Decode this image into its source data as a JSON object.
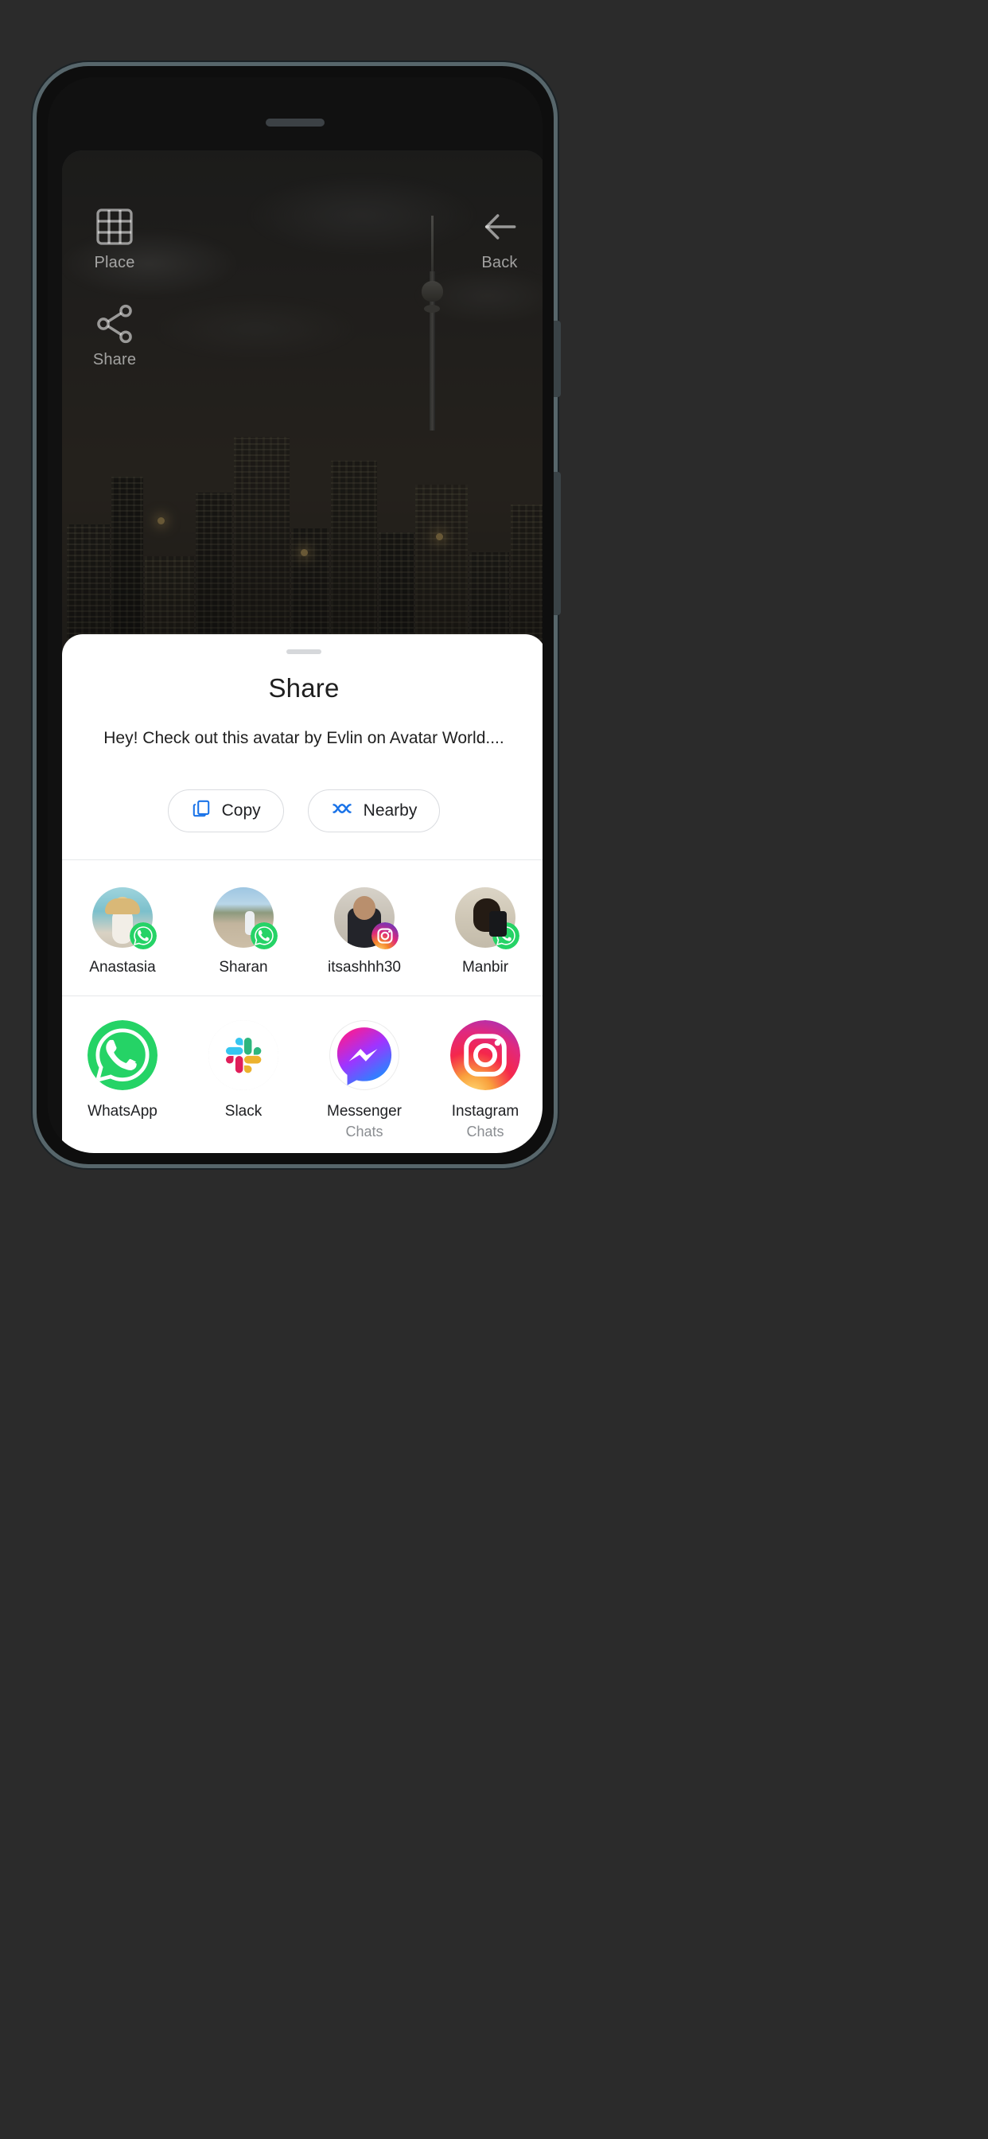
{
  "overlay": {
    "place_label": "Place",
    "share_label": "Share",
    "back_label": "Back",
    "place_icon": "grid-icon",
    "share_icon": "share-nodes-icon",
    "back_icon": "arrow-left-icon"
  },
  "sheet": {
    "title": "Share",
    "subtitle": "Hey! Check out this avatar by Evlin on Avatar World....",
    "chips": [
      {
        "label": "Copy",
        "icon": "copy-icon",
        "icon_color": "#1a73e8"
      },
      {
        "label": "Nearby",
        "icon": "nearby-share-icon",
        "icon_color": "#1a73e8"
      }
    ],
    "contacts": [
      {
        "name": "Anastasia",
        "app_badge": "whatsapp-icon",
        "badge_color": "#25D366"
      },
      {
        "name": "Sharan",
        "app_badge": "whatsapp-icon",
        "badge_color": "#25D366"
      },
      {
        "name": "itsashhh30",
        "app_badge": "instagram-icon",
        "badge_color": "#E1306C"
      },
      {
        "name": "Manbir",
        "app_badge": "whatsapp-icon",
        "badge_color": "#25D366"
      }
    ],
    "apps": [
      {
        "name": "WhatsApp",
        "sublabel": "",
        "icon": "whatsapp-icon",
        "color": "#25D366"
      },
      {
        "name": "Slack",
        "sublabel": "",
        "icon": "slack-icon",
        "color": "#ECB22E"
      },
      {
        "name": "Messenger",
        "sublabel": "Chats",
        "icon": "messenger-icon",
        "color": "#A033FF"
      },
      {
        "name": "Instagram",
        "sublabel": "Chats",
        "icon": "instagram-icon",
        "color": "#E1306C"
      }
    ]
  },
  "colors": {
    "accent_blue": "#1a73e8",
    "sheet_background": "#ffffff",
    "page_background": "#2b2b2b",
    "text_primary": "#202124",
    "text_secondary": "#8a8d91"
  }
}
